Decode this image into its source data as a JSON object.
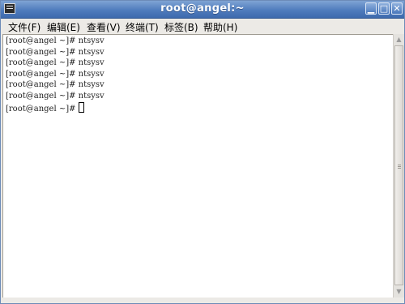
{
  "window": {
    "title": "root@angel:~",
    "icon": "terminal-icon",
    "controls": {
      "minimize": "▁",
      "maximize": "□",
      "close": "✕"
    }
  },
  "menu": {
    "items": [
      {
        "label": "文件(F)"
      },
      {
        "label": "编辑(E)"
      },
      {
        "label": "查看(V)"
      },
      {
        "label": "终端(T)"
      },
      {
        "label": "标签(B)"
      },
      {
        "label": "帮助(H)"
      }
    ]
  },
  "terminal": {
    "lines": [
      "[root@angel ~]# ntsysv",
      "[root@angel ~]# ntsysv",
      "[root@angel ~]# ntsysv",
      "[root@angel ~]# ntsysv",
      "[root@angel ~]# ntsysv",
      "[root@angel ~]# ntsysv"
    ],
    "prompt": "[root@angel ~]#"
  },
  "scrollbar": {
    "up_arrow": "▲",
    "down_arrow": "▼"
  },
  "colors": {
    "titlebar": "#4f7cbd",
    "background": "#ffffff",
    "chrome": "#eceae6"
  }
}
